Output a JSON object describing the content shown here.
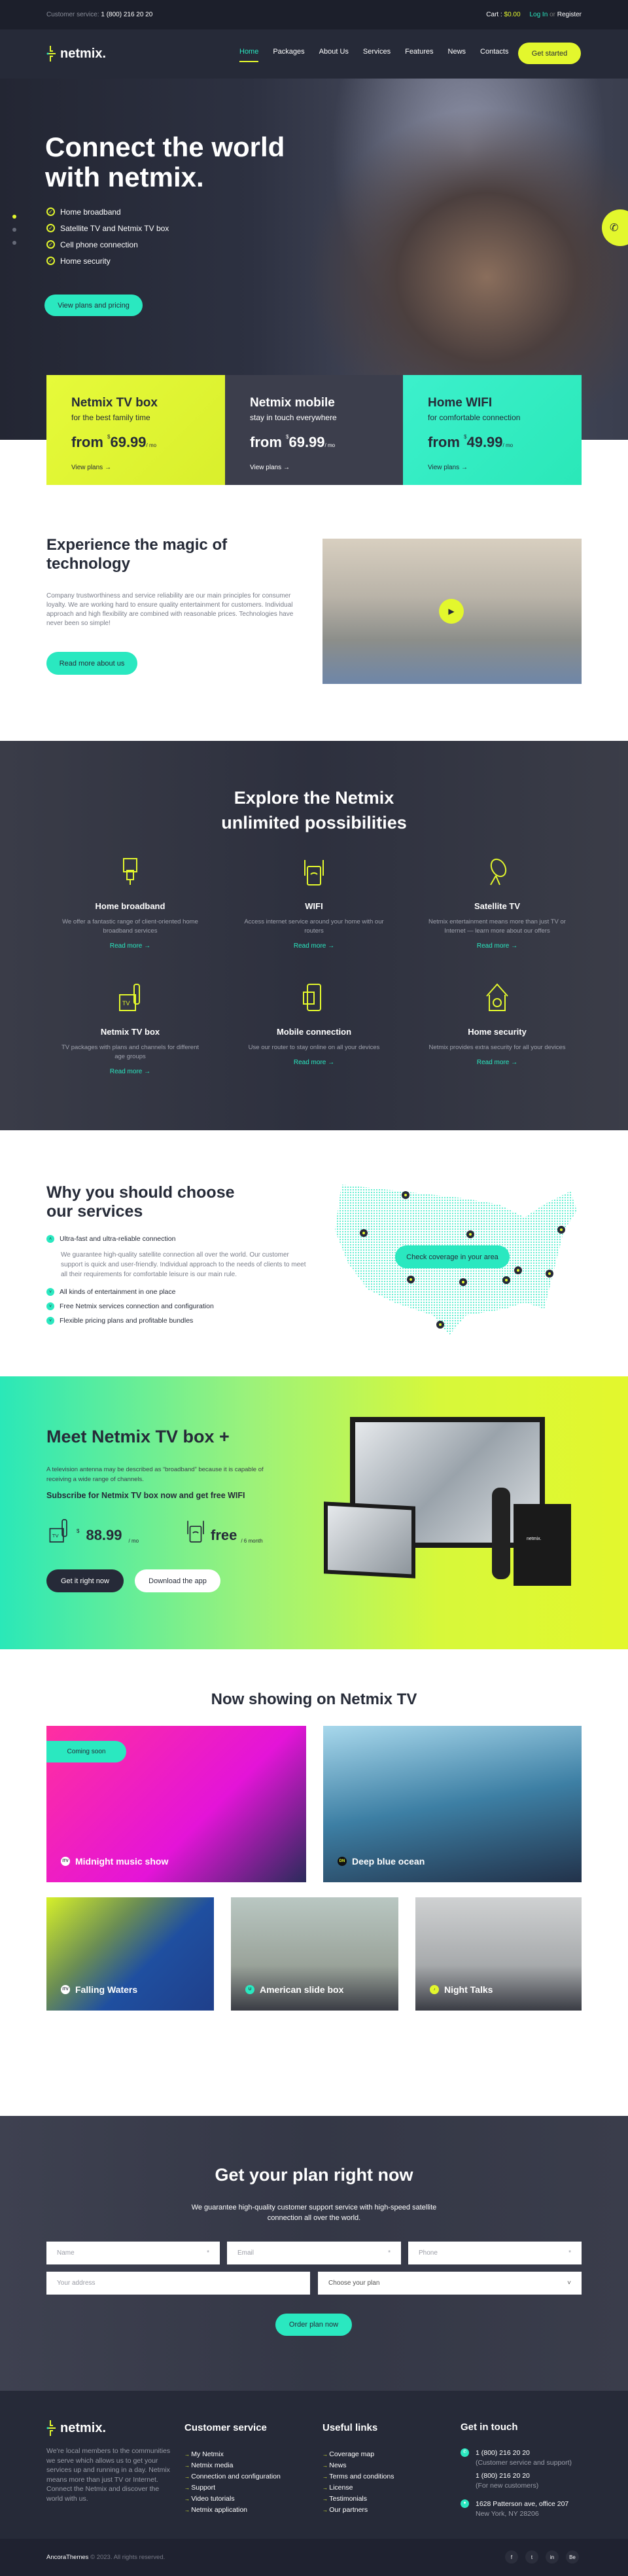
{
  "colors": {
    "accent_yellow": "#e3f72d",
    "accent_green": "#2ae8c0",
    "dark": "#262a38"
  },
  "topbar": {
    "service_label": "Customer service:",
    "service_phone": "1 (800) 216 20 20",
    "cart_label": "Cart :",
    "cart_value": "$0.00",
    "login": "Log In",
    "or": "or",
    "register": "Register"
  },
  "nav": {
    "logo": "netmix.",
    "items": [
      "Home",
      "Packages",
      "About Us",
      "Services",
      "Features",
      "News",
      "Contacts"
    ],
    "cta": "Get started"
  },
  "hero": {
    "title_line1": "Connect the world",
    "title_line2": "with netmix.",
    "features": [
      "Home broadband",
      "Satellite TV and Netmix TV box",
      "Cell phone connection",
      "Home security"
    ],
    "button": "View plans and pricing",
    "phone_icon": "phone-icon"
  },
  "plans": [
    {
      "title": "Netmix TV box",
      "subtitle": "for the best family time",
      "from": "from",
      "currency": "$",
      "price": "69.99",
      "per": "/ mo",
      "link": "View plans"
    },
    {
      "title": "Netmix mobile",
      "subtitle": "stay in touch everywhere",
      "from": "from",
      "currency": "$",
      "price": "69.99",
      "per": "/ mo",
      "link": "View plans"
    },
    {
      "title": "Home WIFI",
      "subtitle": "for comfortable connection",
      "from": "from",
      "currency": "$",
      "price": "49.99",
      "per": "/ mo",
      "link": "View plans"
    }
  ],
  "about": {
    "title_line1": "Experience the magic of",
    "title_line2": "technology",
    "text": "Company trustworthiness and service reliability are our main principles for consumer loyalty. We are working hard to ensure quality entertainment for customers. Individual approach and high flexibility are combined with reasonable prices. Technologies have never been so simple!",
    "button": "Read more about us"
  },
  "services": {
    "title_line1": "Explore the Netmix",
    "title_line2": "unlimited possibilities",
    "read_more": "Read more",
    "items": [
      {
        "title": "Home broadband",
        "text": "We offer a fantastic range of client-oriented home broadband services",
        "icon": "ethernet-icon"
      },
      {
        "title": "WIFI",
        "text": "Access internet service around your home with our routers",
        "icon": "router-icon"
      },
      {
        "title": "Satellite TV",
        "text": "Netmix entertainment means more than just TV or Internet — learn more about our offers",
        "icon": "satellite-dish-icon"
      },
      {
        "title": "Netmix TV box",
        "text": "TV packages with plans and channels for different age groups",
        "icon": "tv-box-icon"
      },
      {
        "title": "Mobile connection",
        "text": "Use our router to stay online on all your devices",
        "icon": "mobile-wifi-icon"
      },
      {
        "title": "Home security",
        "text": "Netmix provides extra security for all your devices",
        "icon": "home-security-icon"
      }
    ]
  },
  "why": {
    "title_line1": "Why you should choose",
    "title_line2": "our services",
    "items": [
      "Ultra-fast and ultra-reliable connection",
      "All kinds of entertainment in one place",
      "Free Netmix services connection and configuration",
      "Flexible pricing plans and profitable bundles"
    ],
    "expanded_text": "We guarantee high-quality satellite connection all over the world. Our customer support is quick and user-friendly. Individual approach to the needs of clients to meet all their requirements for comfortable leisure is our main rule.",
    "map_button": "Check coverage in your area"
  },
  "tvbox": {
    "title": "Meet Netmix TV box +",
    "text": "A television antenna may be described as “broadband” because it is capable of receiving a wide range of channels.",
    "subscribe": "Subscribe for Netmix TV box now and get free WIFI",
    "price_currency": "$",
    "price": "88.99",
    "price_per": "/ mo",
    "free": "free",
    "free_per": "/ 6 month",
    "btn_primary": "Get it right now",
    "btn_secondary": "Download the app",
    "device_logo": "netmix."
  },
  "showing": {
    "title": "Now showing on Netmix TV",
    "badge": "Coming soon",
    "items": [
      {
        "title": "Midnight music show",
        "channel": "ITV"
      },
      {
        "title": "Deep blue ocean",
        "channel": "DN"
      },
      {
        "title": "Falling Waters",
        "channel": "ITV"
      },
      {
        "title": "American slide box",
        "channel": "U"
      },
      {
        "title": "Night Talks",
        "channel": "♪"
      }
    ]
  },
  "order": {
    "title": "Get your plan right now",
    "text": "We guarantee high-quality customer support service with high-speed satellite connection all over the world.",
    "name": "Name",
    "email": "Email",
    "phone": "Phone",
    "address": "Your address",
    "plan": "Choose your plan",
    "required": "*",
    "button": "Order plan now"
  },
  "footer": {
    "logo": "netmix.",
    "about": "We're local members to the communities we serve which allows us to get your services up and running in a day. Netmix  means more than just TV or Internet. Connect the Netmix and discover the world with us.",
    "customer_title": "Customer service",
    "customer_links": [
      "My Netmix",
      "Netmix media",
      "Connection and configuration",
      "Support",
      "Video tutorials",
      "Netmix application"
    ],
    "useful_title": "Useful links",
    "useful_links": [
      "Coverage map",
      "News",
      "Terms and conditions",
      "License",
      "Testimonials",
      "Our partners"
    ],
    "contact_title": "Get in touch",
    "phone1": "1 (800) 216 20 20",
    "phone1_note": "(Customer service and support)",
    "phone2": "1 (800) 216 20 20",
    "phone2_note": "(For new customers)",
    "address1": "1628 Patterson ave, office 207",
    "address2": "New York, NY 28206",
    "brand": "AncoraThemes",
    "copyright": "© 2023. All rights reserved.",
    "social": [
      "f",
      "t",
      "in",
      "Be"
    ]
  }
}
